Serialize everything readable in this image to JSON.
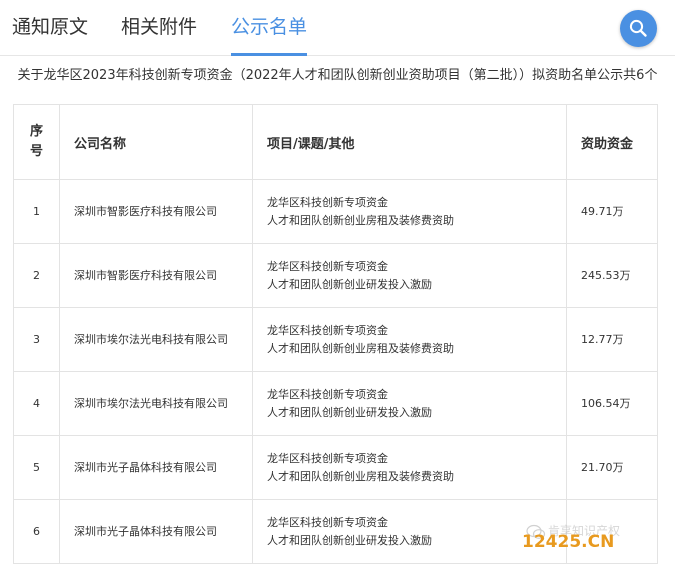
{
  "tabs": [
    {
      "label": "通知原文",
      "active": false
    },
    {
      "label": "相关附件",
      "active": false
    },
    {
      "label": "公示名单",
      "active": true
    }
  ],
  "colors": {
    "accent": "#4a90e2",
    "border": "#e3e3e3",
    "text": "#333333",
    "watermark": "#e89a1f"
  },
  "search_icon": "search-icon",
  "announcement": "关于龙华区2023年科技创新专项资金（2022年人才和团队创新创业资助项目（第二批））拟资助名单公示共6个",
  "table": {
    "headers": {
      "index": "序号",
      "company": "公司名称",
      "project": "项目/课题/其他",
      "amount": "资助资金"
    },
    "rows": [
      {
        "index": "1",
        "company": "深圳市智影医疗科技有限公司",
        "project_line1": "龙华区科技创新专项资金",
        "project_line2": "人才和团队创新创业房租及装修费资助",
        "amount": "49.71万"
      },
      {
        "index": "2",
        "company": "深圳市智影医疗科技有限公司",
        "project_line1": "龙华区科技创新专项资金",
        "project_line2": "人才和团队创新创业研发投入激励",
        "amount": "245.53万"
      },
      {
        "index": "3",
        "company": "深圳市埃尔法光电科技有限公司",
        "project_line1": "龙华区科技创新专项资金",
        "project_line2": "人才和团队创新创业房租及装修费资助",
        "amount": "12.77万"
      },
      {
        "index": "4",
        "company": "深圳市埃尔法光电科技有限公司",
        "project_line1": "龙华区科技创新专项资金",
        "project_line2": "人才和团队创新创业研发投入激励",
        "amount": "106.54万"
      },
      {
        "index": "5",
        "company": "深圳市光子晶体科技有限公司",
        "project_line1": "龙华区科技创新专项资金",
        "project_line2": "人才和团队创新创业房租及装修费资助",
        "amount": "21.70万"
      },
      {
        "index": "6",
        "company": "深圳市光子晶体科技有限公司",
        "project_line1": "龙华区科技创新专项资金",
        "project_line2": "人才和团队创新创业研发投入激励",
        "amount": ""
      }
    ]
  },
  "watermark": {
    "site": "12425.CN",
    "faint_text": "肯享知识产权"
  }
}
